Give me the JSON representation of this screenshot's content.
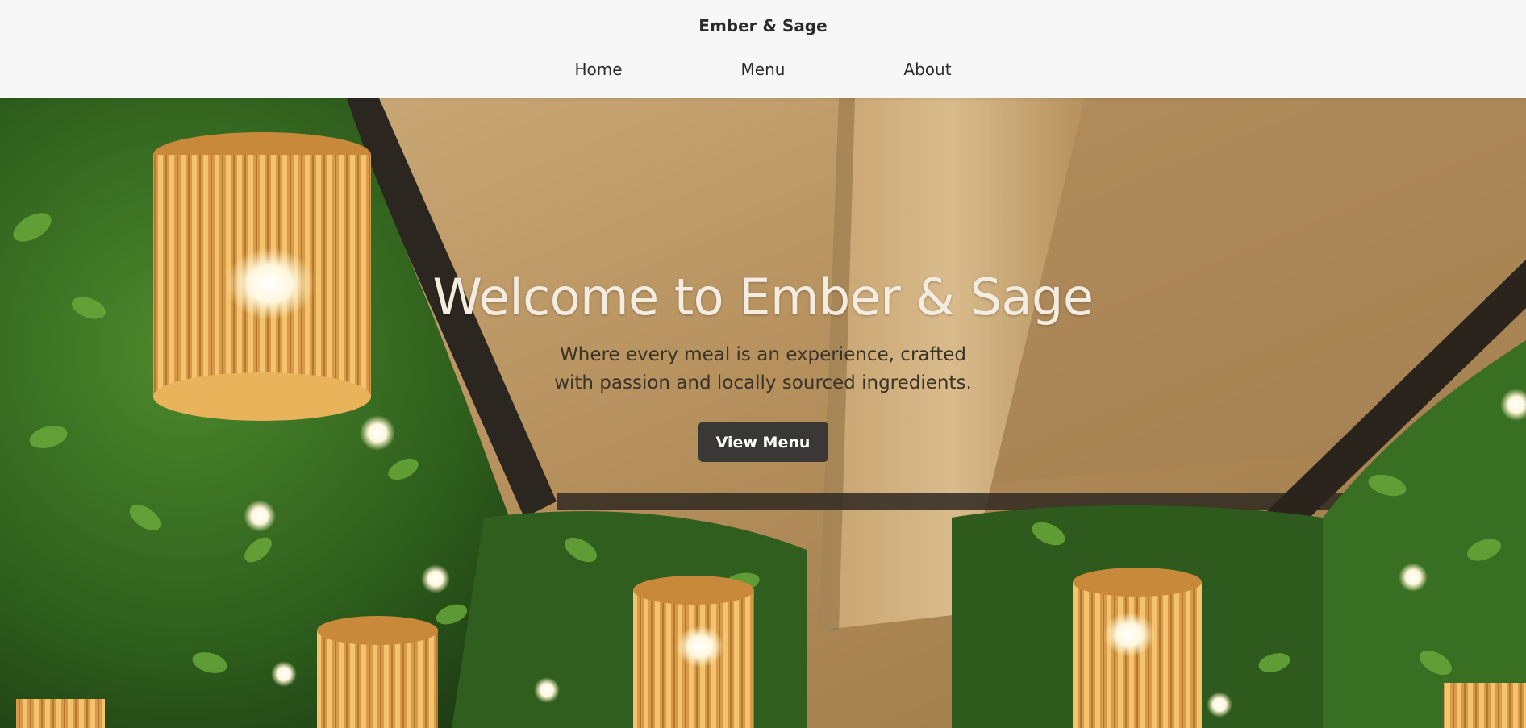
{
  "header": {
    "brand": "Ember & Sage",
    "nav": [
      {
        "label": "Home"
      },
      {
        "label": "Menu"
      },
      {
        "label": "About"
      }
    ]
  },
  "hero": {
    "title": "Welcome to Ember & Sage",
    "subtitle": "Where every meal is an experience, crafted with passion and locally sourced ingredients.",
    "cta_label": "View Menu"
  },
  "colors": {
    "header_bg": "#f7f7f7",
    "text_dark": "#2b2b2b",
    "button_bg": "#3a3836",
    "hero_title": "#f4ece0"
  }
}
